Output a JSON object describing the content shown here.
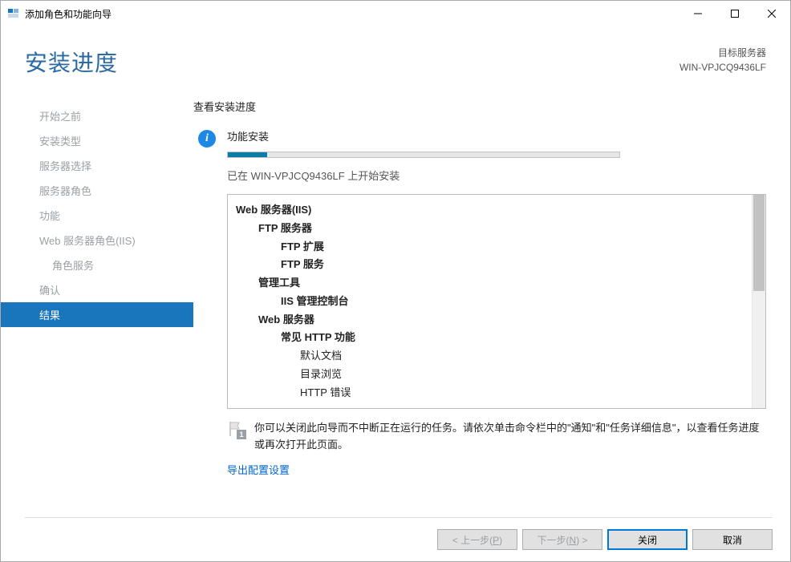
{
  "window": {
    "title": "添加角色和功能向导"
  },
  "header": {
    "title": "安装进度",
    "dest_label": "目标服务器",
    "dest_server": "WIN-VPJCQ9436LF"
  },
  "sidebar": {
    "items": [
      {
        "label": "开始之前",
        "selected": false
      },
      {
        "label": "安装类型",
        "selected": false
      },
      {
        "label": "服务器选择",
        "selected": false
      },
      {
        "label": "服务器角色",
        "selected": false
      },
      {
        "label": "功能",
        "selected": false
      },
      {
        "label": "Web 服务器角色(IIS)",
        "selected": false
      },
      {
        "label": "角色服务",
        "selected": false,
        "sub": true
      },
      {
        "label": "确认",
        "selected": false
      },
      {
        "label": "结果",
        "selected": true
      }
    ]
  },
  "content": {
    "section_title": "查看安装进度",
    "install_label": "功能安装",
    "progress_percent": 10,
    "status_text": "已在 WIN-VPJCQ9436LF 上开始安装",
    "features": [
      {
        "level": 0,
        "text": "Web 服务器(IIS)"
      },
      {
        "level": 1,
        "text": "FTP 服务器"
      },
      {
        "level": 2,
        "text": "FTP 扩展"
      },
      {
        "level": 2,
        "text": "FTP 服务"
      },
      {
        "level": 1,
        "text": "管理工具"
      },
      {
        "level": 2,
        "text": "IIS 管理控制台"
      },
      {
        "level": 1,
        "text": "Web 服务器"
      },
      {
        "level": 2,
        "text": "常见 HTTP 功能"
      },
      {
        "level": 3,
        "text": "默认文档"
      },
      {
        "level": 3,
        "text": "目录浏览"
      },
      {
        "level": 3,
        "text": "HTTP 错误"
      }
    ],
    "hint_text": "你可以关闭此向导而不中断正在运行的任务。请依次单击命令栏中的\"通知\"和\"任务详细信息\"，以查看任务进度或再次打开此页面。",
    "export_link": "导出配置设置"
  },
  "footer": {
    "prev": "< 上一步(P)",
    "next": "下一步(N) >",
    "close": "关闭",
    "cancel": "取消"
  }
}
